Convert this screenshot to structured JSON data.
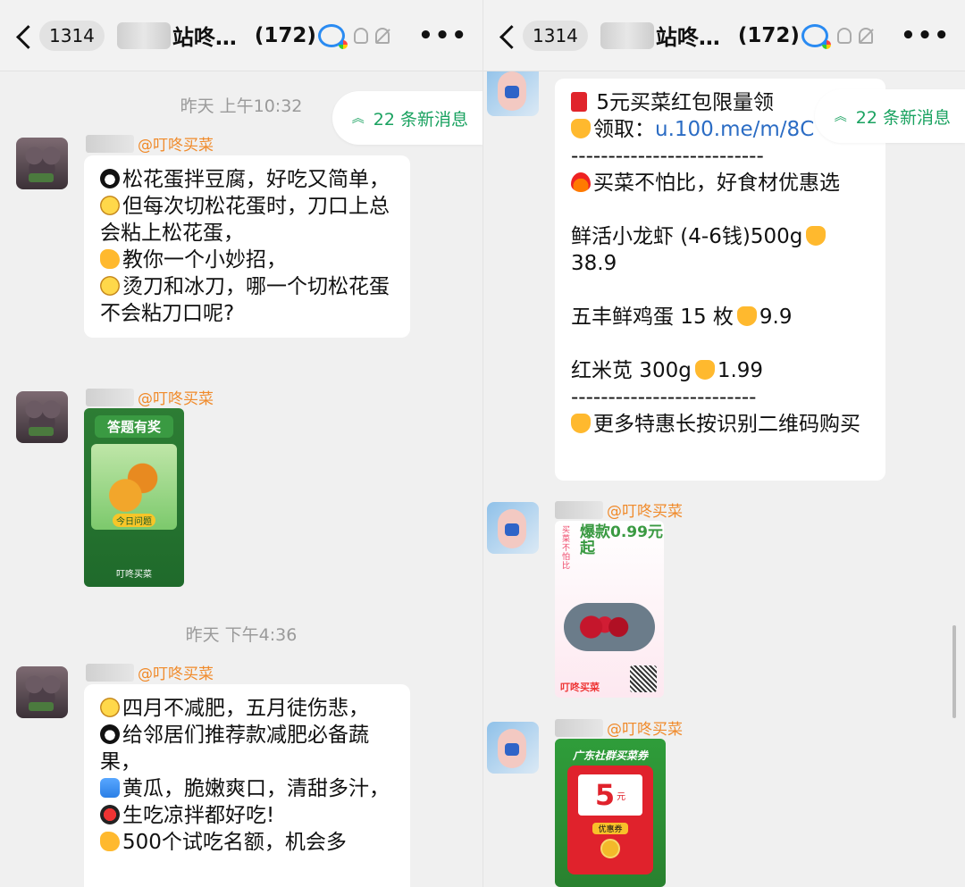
{
  "left": {
    "header": {
      "unread_count": "1314",
      "title": "站咚…",
      "member_count": "(172)"
    },
    "new_messages": "22 条新消息",
    "timestamps": [
      "昨天 上午10:32",
      "昨天 下午4:36"
    ],
    "sender_tag": "@叮咚买菜",
    "messages": [
      {
        "lines": [
          "松花蛋拌豆腐，好吃又简单，",
          "但每次切松花蛋时，刀口上总会粘上松花蛋，",
          "教你一个小妙招，",
          "烫刀和冰刀，哪一个切松花蛋不会粘刀口呢?"
        ]
      },
      {
        "image": {
          "title": "答题有奖",
          "tag": "今日问题",
          "logo": "叮咚买菜"
        }
      },
      {
        "lines": [
          "四月不减肥，五月徒伤悲，",
          "给邻居们推荐款减肥必备蔬果，",
          "黄瓜，脆嫩爽口，清甜多汁，",
          "生吃凉拌都好吃!",
          "500个试吃名额，机会多"
        ]
      }
    ]
  },
  "right": {
    "header": {
      "unread_count": "1314",
      "title": "站咚…",
      "member_count": "(172)"
    },
    "new_messages": "22 条新消息",
    "sender_tag": "@叮咚买菜",
    "bubble": {
      "line1": "5元买菜红包限量领",
      "line2_prefix": "领取：",
      "link": "u.100.me/m/8C",
      "divider1": "--------------------------",
      "line3": "买菜不怕比，好食材优惠选",
      "item1": "鲜活小龙虾 (4-6钱)500g",
      "item1_price": "38.9",
      "item2": "五丰鲜鸡蛋 15 枚",
      "item2_price": "9.9",
      "item3": "红米苋 300g",
      "item3_price": "1.99",
      "divider2": "-------------------------",
      "line4": "更多特惠长按识别二维码购买"
    },
    "promo_image": {
      "side": "买菜不怕比",
      "head": "爆款0.99元起",
      "logo": "叮咚买菜"
    },
    "coupon_image": {
      "head": "广东社群买菜券",
      "amount": "5",
      "unit": "元",
      "tag": "优惠券"
    }
  }
}
